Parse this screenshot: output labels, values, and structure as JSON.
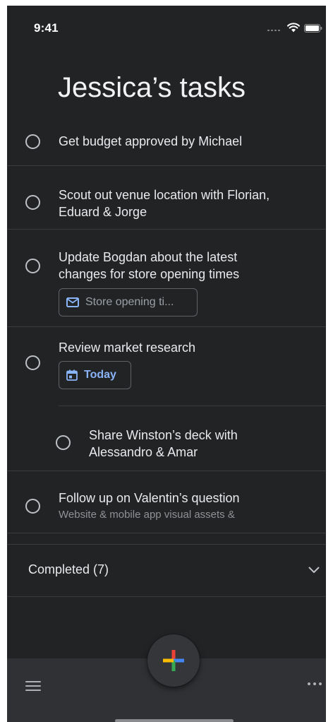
{
  "status_bar": {
    "time": "9:41"
  },
  "header": {
    "title": "Jessica’s tasks"
  },
  "tasks": [
    {
      "title_lines": [
        "Get budget approved by Michael"
      ]
    },
    {
      "title_lines": [
        "Scout out venue location with Florian,",
        "Eduard & Jorge"
      ]
    },
    {
      "title_lines": [
        "Update Bogdan about the latest",
        "changes for store opening times"
      ],
      "chip": {
        "icon": "mail-icon",
        "label": "Store opening ti..."
      }
    },
    {
      "title_lines": [
        "Review market research"
      ],
      "chip": {
        "icon": "calendar-icon",
        "label": "Today"
      },
      "subtasks": [
        {
          "title_lines": [
            "Share Winston’s deck with",
            "Alessandro & Amar"
          ]
        }
      ]
    },
    {
      "title_lines": [
        "Follow up on Valentin’s question"
      ],
      "subtitle": "Website & mobile app visual assets &"
    }
  ],
  "completed": {
    "label": "Completed (7)",
    "icon": "chevron-down-icon"
  },
  "bottom_bar": {
    "menu_icon": "menu-icon",
    "more_icon": "more-options-icon",
    "fab_icon": "add-icon"
  },
  "colors": {
    "background": "#222325",
    "bottom_bar": "#303134",
    "text": "#e8eaed",
    "secondary_text": "#8e9196",
    "accent_blue": "#8ab4f8",
    "fab_blue": "#4285f4",
    "fab_red": "#ea4335",
    "fab_yellow": "#fbbc04",
    "fab_green": "#34a853"
  }
}
